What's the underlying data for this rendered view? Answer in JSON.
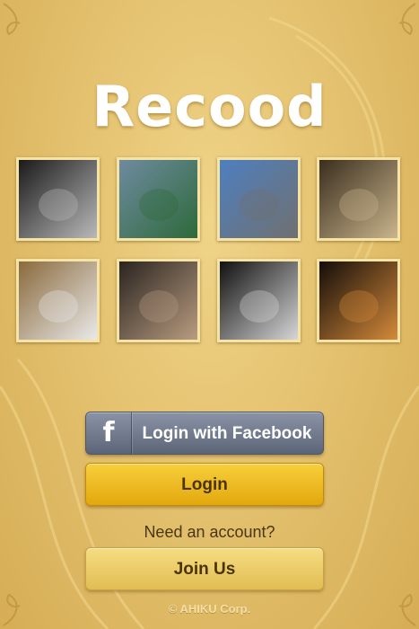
{
  "app": {
    "logo_text": "Recood"
  },
  "photos": [
    {
      "icon": "photo-baby-bw",
      "colors": [
        "#1a1a1a",
        "#b9b9b9"
      ]
    },
    {
      "icon": "photo-playground",
      "colors": [
        "#6f8aa0",
        "#2d6a3a"
      ]
    },
    {
      "icon": "photo-street",
      "colors": [
        "#4e7fbf",
        "#707070"
      ]
    },
    {
      "icon": "photo-gym",
      "colors": [
        "#3a2e1e",
        "#c9b48c"
      ]
    },
    {
      "icon": "photo-kid-curtain",
      "colors": [
        "#8a6a3c",
        "#e9e9e9"
      ]
    },
    {
      "icon": "photo-stairs",
      "colors": [
        "#2a2420",
        "#b89c80"
      ]
    },
    {
      "icon": "photo-girl-face",
      "colors": [
        "#111111",
        "#d6d6d6"
      ]
    },
    {
      "icon": "photo-christmas-lights",
      "colors": [
        "#140d0a",
        "#d48a3a"
      ]
    }
  ],
  "buttons": {
    "facebook_label": "Login with Facebook",
    "login_label": "Login",
    "join_label": "Join Us"
  },
  "prompt_text": "Need an account?",
  "footer_text": "© AHIKU Corp.",
  "colors": {
    "background": "#e4c270",
    "facebook_button": "#6b7487",
    "login_button": "#efbd22",
    "join_button": "#ecd06b"
  }
}
